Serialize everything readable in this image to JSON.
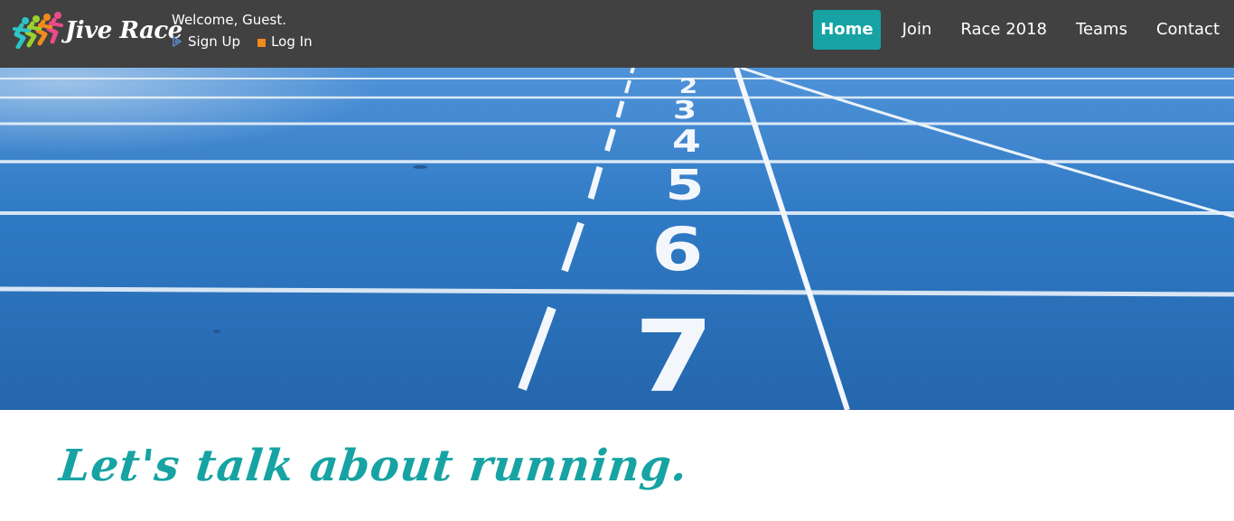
{
  "brand": {
    "name": "Jive Race",
    "runner_colors": [
      "#2cc4c4",
      "#9ad12c",
      "#f28a1c",
      "#e94b8a"
    ]
  },
  "user": {
    "welcome": "Welcome, Guest.",
    "signup_label": "Sign Up",
    "login_label": "Log In",
    "signup_icon": "signup-icon",
    "login_icon": "login-icon"
  },
  "nav": {
    "items": [
      {
        "label": "Home",
        "active": true
      },
      {
        "label": "Join",
        "active": false
      },
      {
        "label": "Race 2018",
        "active": false
      },
      {
        "label": "Teams",
        "active": false
      },
      {
        "label": "Contact",
        "active": false
      }
    ]
  },
  "hero": {
    "lane_numbers": [
      "2",
      "3",
      "4",
      "5",
      "6",
      "7"
    ]
  },
  "main": {
    "tagline": "Let's talk about running."
  },
  "colors": {
    "header_bg": "#414141",
    "accent": "#17a3a3",
    "track_blue": "#2a6fb8",
    "login_icon": "#f28a1c"
  }
}
